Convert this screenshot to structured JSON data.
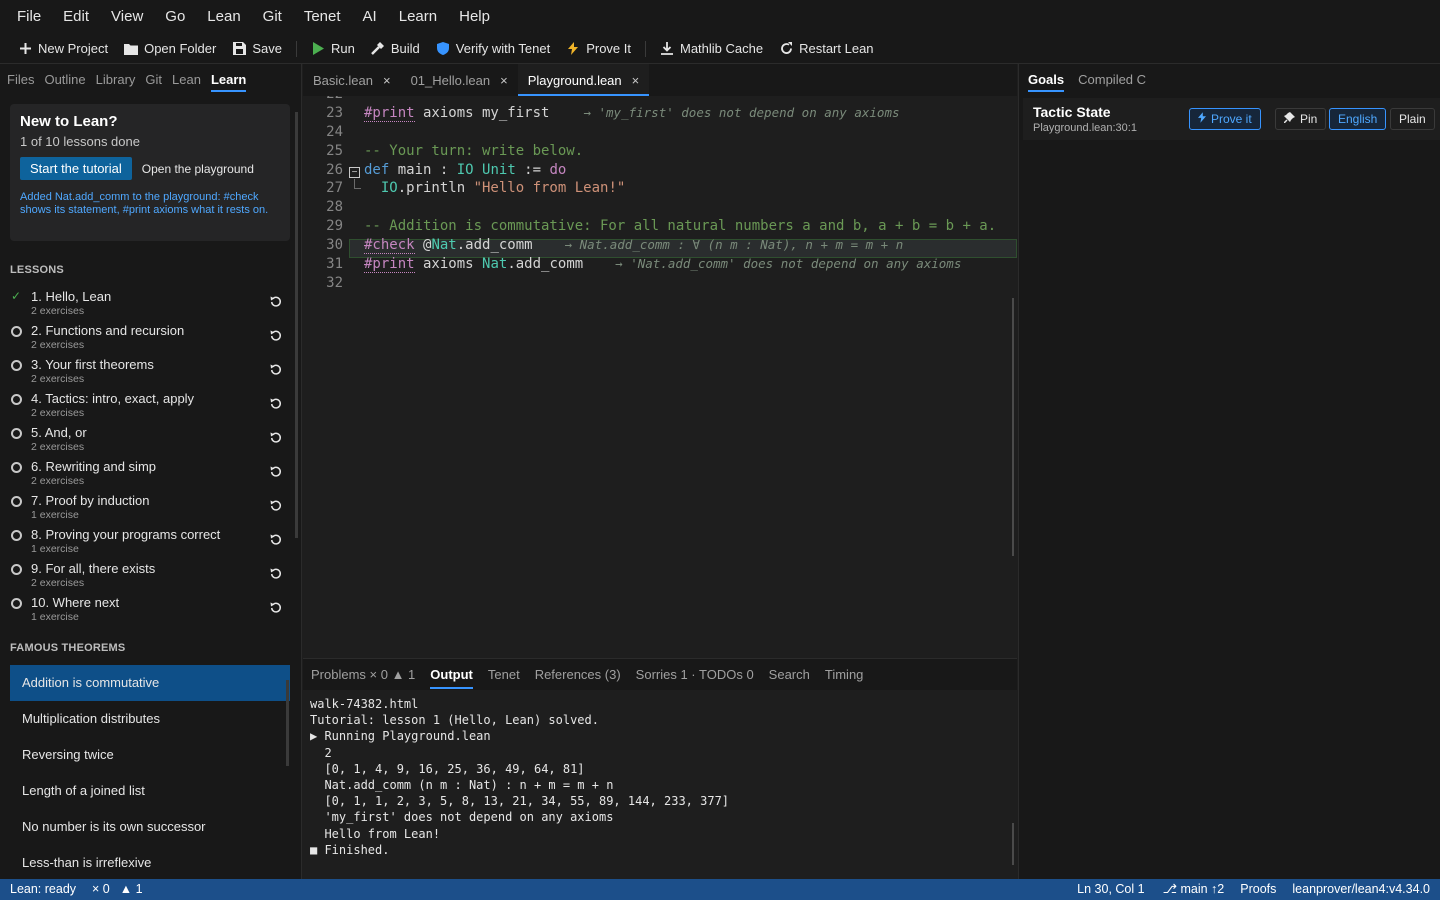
{
  "menu": [
    "File",
    "Edit",
    "View",
    "Go",
    "Lean",
    "Git",
    "Tenet",
    "AI",
    "Learn",
    "Help"
  ],
  "toolbar": {
    "new_project": "New Project",
    "open_folder": "Open Folder",
    "save": "Save",
    "run": "Run",
    "build": "Build",
    "verify": "Verify with Tenet",
    "prove": "Prove It",
    "mathlib": "Mathlib Cache",
    "restart": "Restart Lean"
  },
  "sidebar": {
    "tabs": [
      "Files",
      "Outline",
      "Library",
      "Git",
      "Lean",
      "Learn"
    ],
    "welcome": {
      "title": "New to Lean?",
      "progress": "1 of 10 lessons done",
      "start_btn": "Start the tutorial",
      "playground_btn": "Open the playground",
      "note": "Added Nat.add_comm to the playground: #check shows its statement, #print axioms what it rests on."
    },
    "lessons_head": "LESSONS",
    "lessons": [
      {
        "title": "1. Hello, Lean",
        "sub": "2 exercises",
        "done": true
      },
      {
        "title": "2. Functions and recursion",
        "sub": "2 exercises",
        "done": false
      },
      {
        "title": "3. Your first theorems",
        "sub": "2 exercises",
        "done": false
      },
      {
        "title": "4. Tactics: intro, exact, apply",
        "sub": "2 exercises",
        "done": false
      },
      {
        "title": "5. And, or",
        "sub": "2 exercises",
        "done": false
      },
      {
        "title": "6. Rewriting and simp",
        "sub": "2 exercises",
        "done": false
      },
      {
        "title": "7. Proof by induction",
        "sub": "1 exercise",
        "done": false
      },
      {
        "title": "8. Proving your programs correct",
        "sub": "1 exercise",
        "done": false
      },
      {
        "title": "9. For all, there exists",
        "sub": "2 exercises",
        "done": false
      },
      {
        "title": "10. Where next",
        "sub": "1 exercise",
        "done": false
      }
    ],
    "famous_head": "FAMOUS THEOREMS",
    "famous": [
      "Addition is commutative",
      "Multiplication distributes",
      "Reversing twice",
      "Length of a joined list",
      "No number is its own successor",
      "Less-than is irreflexive"
    ]
  },
  "editor": {
    "tabs": [
      "Basic.lean",
      "01_Hello.lean",
      "Playground.lean"
    ],
    "line_numbers": [
      "23",
      "24",
      "25",
      "26",
      "27",
      "28",
      "29",
      "30",
      "31",
      "32"
    ],
    "top_partial": "22",
    "lines": {
      "l23_a": "#print",
      "l23_b": " axioms my_first",
      "l23_hint": "→ 'my_first' does not depend on any axioms",
      "l25": "-- Your turn: write below.",
      "l26_kw": "def",
      "l26_name": " main : ",
      "l26_ty1": "IO",
      "l26_sp": " ",
      "l26_ty2": "Unit",
      "l26_rest": " := ",
      "l26_do": "do",
      "l27_ty": "IO",
      "l27_fn": ".println ",
      "l27_str": "\"Hello from Lean!\"",
      "l29": "-- Addition is commutative: For all natural numbers a and b, a + b = b + a.",
      "l30_a": "#check",
      "l30_at": " @",
      "l30_ty": "Nat",
      "l30_b": ".add_comm",
      "l30_hint": "→ Nat.add_comm : ∀ (n m : Nat), n + m = m + n",
      "l31_a": "#print",
      "l31_b": " axioms ",
      "l31_ty": "Nat",
      "l31_c": ".add_comm",
      "l31_hint": "→ 'Nat.add_comm' does not depend on any axioms"
    }
  },
  "panel": {
    "tabs": [
      "Problems  × 0  ▲ 1",
      "Output",
      "Tenet",
      "References (3)",
      "Sorries 1 · TODOs 0",
      "Search",
      "Timing"
    ],
    "output": [
      "walk-74382.html",
      "Tutorial: lesson 1 (Hello, Lean) solved.",
      "▶ Running Playground.lean",
      "  2",
      "  [0, 1, 4, 9, 16, 25, 36, 49, 64, 81]",
      "  Nat.add_comm (n m : Nat) : n + m = m + n",
      "  [0, 1, 1, 2, 3, 5, 8, 13, 21, 34, 55, 89, 144, 233, 377]",
      "  'my_first' does not depend on any axioms",
      "  Hello from Lean!",
      "■ Finished."
    ]
  },
  "right": {
    "tabs": [
      "Goals",
      "Compiled C"
    ],
    "title": "Tactic State",
    "location": "Playground.lean:30:1",
    "prove_btn": "Prove it",
    "pin_btn": "Pin",
    "english_btn": "English",
    "plain_btn": "Plain"
  },
  "status": {
    "lean": "Lean: ready",
    "errors": "× 0",
    "warnings": "▲ 1",
    "position": "Ln 30, Col 1",
    "branch": "⎇ main ↑2",
    "proofs": "Proofs",
    "toolchain": "leanprover/lean4:v4.34.0"
  },
  "colors": {
    "accent": "#3794ff",
    "statusbar": "#1c4f8a",
    "selected": "#0e4f88",
    "done": "#4caf50"
  }
}
